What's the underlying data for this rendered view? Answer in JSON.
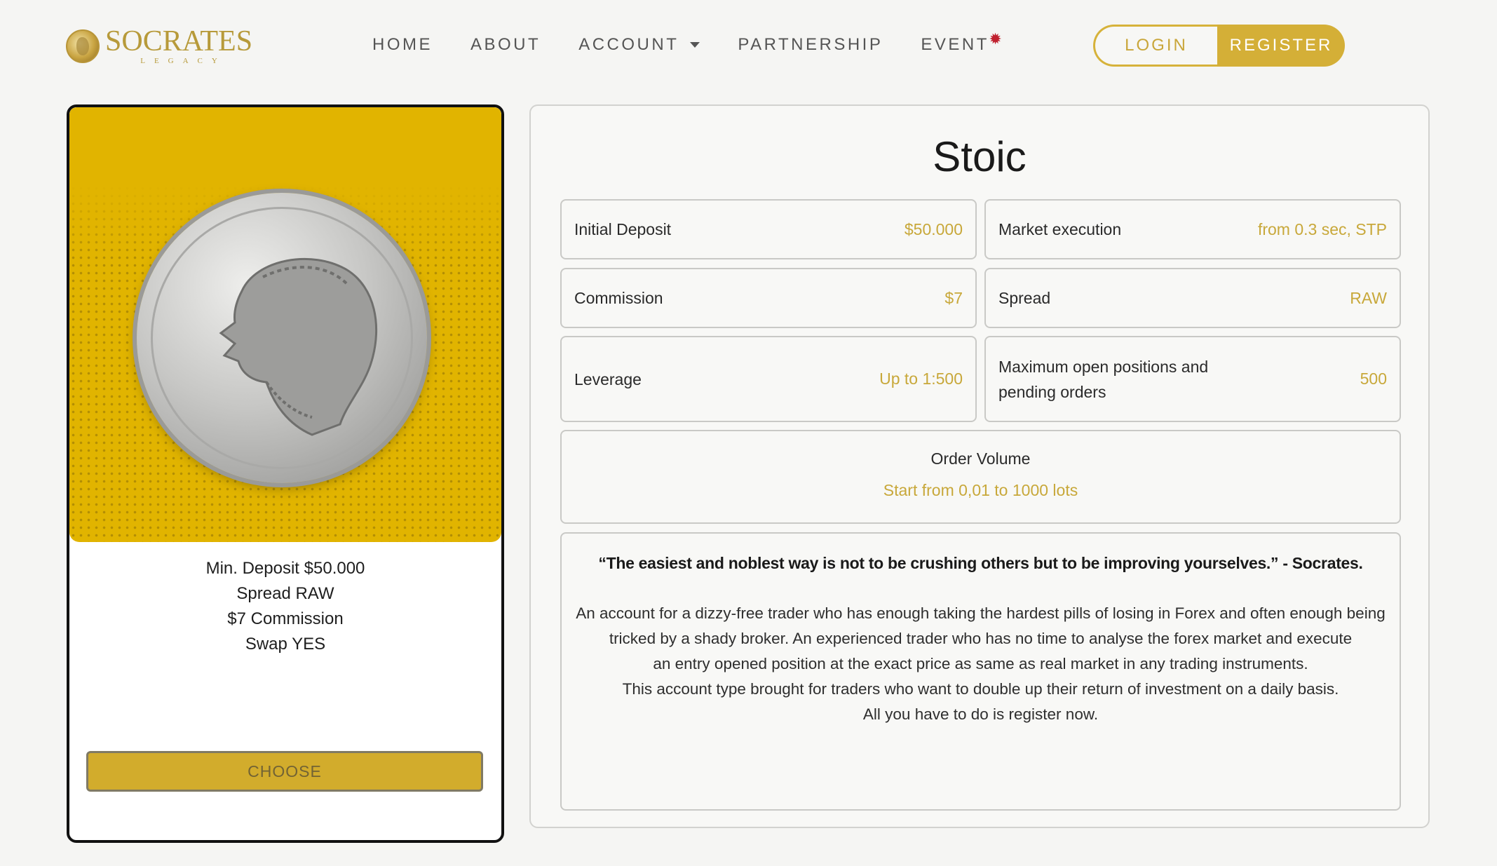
{
  "brand": {
    "title": "SOCRATES",
    "subtitle": "LEGACY",
    "logo_icon": "gold-coin-icon"
  },
  "nav": {
    "items": [
      {
        "label": "HOME"
      },
      {
        "label": "ABOUT"
      },
      {
        "label": "ACCOUNT",
        "has_dropdown": true
      },
      {
        "label": "PARTNERSHIP"
      },
      {
        "label": "EVENT",
        "badge": "✹"
      }
    ],
    "login_label": "LOGIN",
    "register_label": "REGISTER"
  },
  "card": {
    "image_icon": "socrates-coin-icon",
    "info_lines": [
      "Min. Deposit $50.000",
      "Spread RAW",
      "$7 Commission",
      "Swap YES"
    ],
    "choose_label": "CHOOSE"
  },
  "panel": {
    "title": "Stoic",
    "specs": [
      {
        "label": "Initial Deposit",
        "value": "$50.000"
      },
      {
        "label": "Market execution",
        "value": "from 0.3 sec, STP"
      },
      {
        "label": "Commission",
        "value": "$7"
      },
      {
        "label": "Spread",
        "value": "RAW"
      },
      {
        "label": "Leverage",
        "value": "Up to 1:500"
      },
      {
        "label": "Maximum open positions and pending orders",
        "value": "500"
      }
    ],
    "volume": {
      "label": "Order Volume",
      "value": "Start from 0,01 to 1000 lots"
    },
    "quote": "“The easiest and noblest way is not to be crushing others but to be improving yourselves.” - Socrates.",
    "description_lines": [
      "An account for a dizzy-free trader who has enough taking the hardest pills of losing in Forex and often enough being",
      "tricked by a shady broker. An experienced trader who has no time to analyse the forex market and execute",
      "an entry opened position at the exact price as same as real market in any trading instruments.",
      "This account type brought for traders who want to double up their return of investment on a daily basis.",
      "All you have to do is register now."
    ]
  },
  "colors": {
    "accent": "#d4af37",
    "card_hero": "#e1b400",
    "value_text": "#c8a83a",
    "event_badge": "#c0212f"
  }
}
